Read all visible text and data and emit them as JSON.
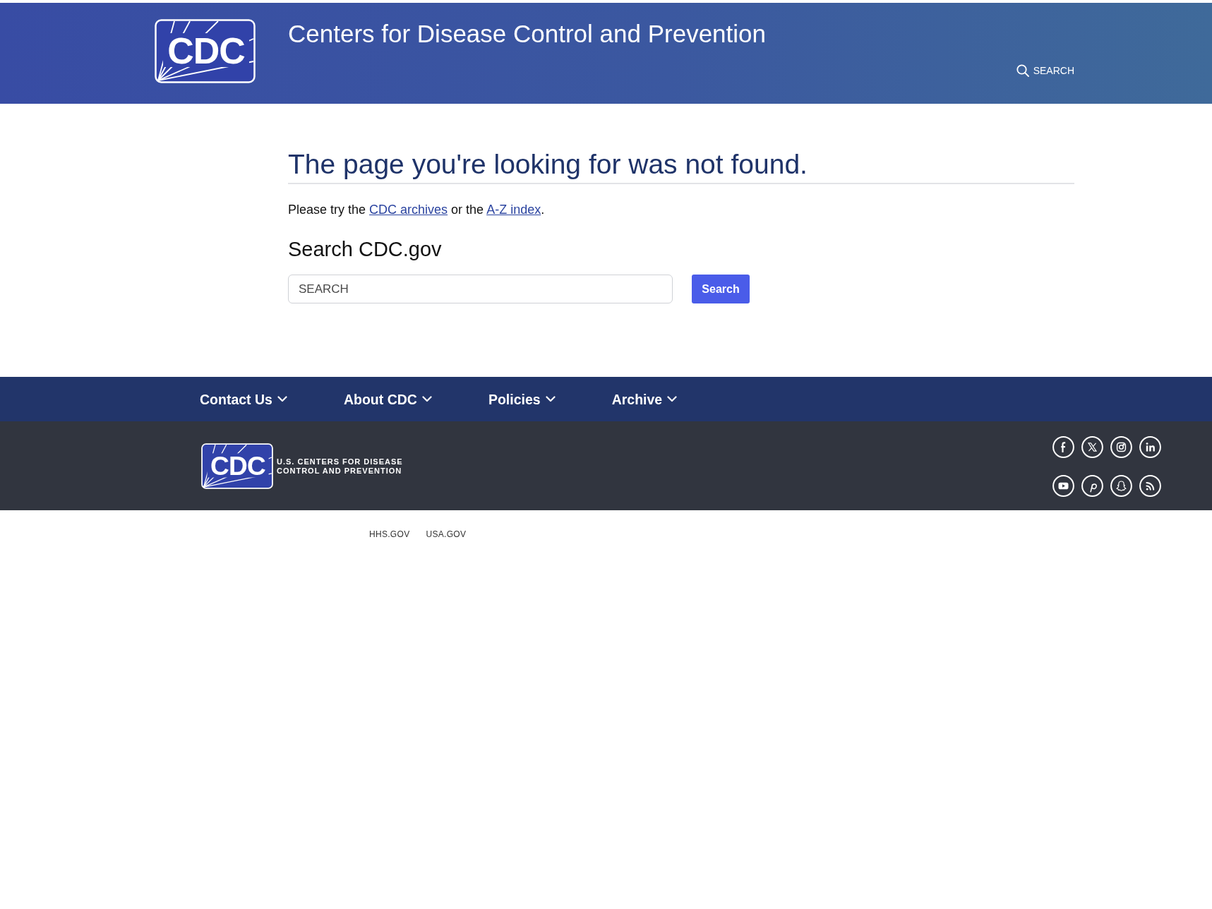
{
  "header": {
    "logo_text": "CDC",
    "title": "Centers for Disease Control and Prevention",
    "search_label": "SEARCH"
  },
  "main": {
    "heading": "The page you're looking for was not found.",
    "message": [
      {
        "kind": "text",
        "text": "Please try the "
      },
      {
        "kind": "link",
        "text": "CDC archives"
      },
      {
        "kind": "text",
        "text": " or the "
      },
      {
        "kind": "link",
        "text": "A-Z index"
      },
      {
        "kind": "text",
        "text": "."
      }
    ],
    "search_heading": "Search CDC.gov",
    "search_field": {
      "placeholder": "SEARCH"
    },
    "search_button": "Search"
  },
  "footer_nav": [
    {
      "label": "Contact Us"
    },
    {
      "label": "About CDC"
    },
    {
      "label": "Policies"
    },
    {
      "label": "Archive"
    }
  ],
  "footer": {
    "logo_text": "CDC",
    "agency_name": [
      "U.S. CENTERS FOR DISEASE",
      "CONTROL AND PREVENTION"
    ],
    "links": [
      "HHS.GOV",
      "USA.GOV"
    ]
  }
}
